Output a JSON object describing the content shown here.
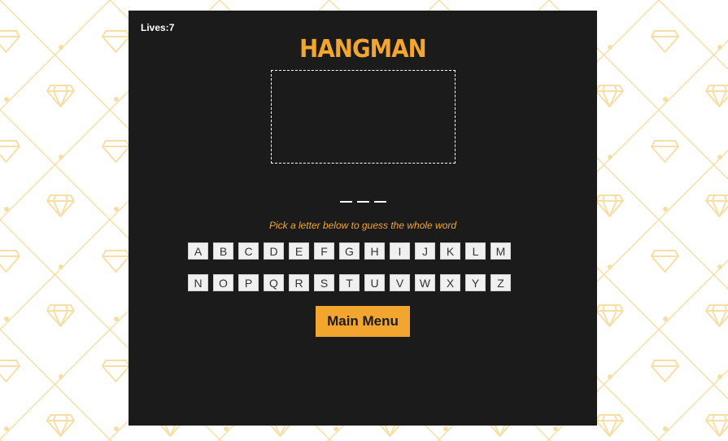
{
  "colors": {
    "accent": "#f2a630",
    "panel": "#1b1b1b",
    "key_bg": "#f0f0f0",
    "pattern": "#f6dfa6"
  },
  "game": {
    "lives_label": "Lives:",
    "lives_value": "7",
    "title": "HANGMAN",
    "word_blanks": [
      "_",
      "_",
      "_"
    ],
    "instructions": "Pick a letter below to guess the whole word",
    "keyboard_row1": [
      "A",
      "B",
      "C",
      "D",
      "E",
      "F",
      "G",
      "H",
      "I",
      "J",
      "K",
      "L",
      "M"
    ],
    "keyboard_row2": [
      "N",
      "O",
      "P",
      "Q",
      "R",
      "S",
      "T",
      "U",
      "V",
      "W",
      "X",
      "Y",
      "Z"
    ],
    "main_menu_label": "Main Menu"
  },
  "background": {
    "icon": "diamond-icon"
  }
}
